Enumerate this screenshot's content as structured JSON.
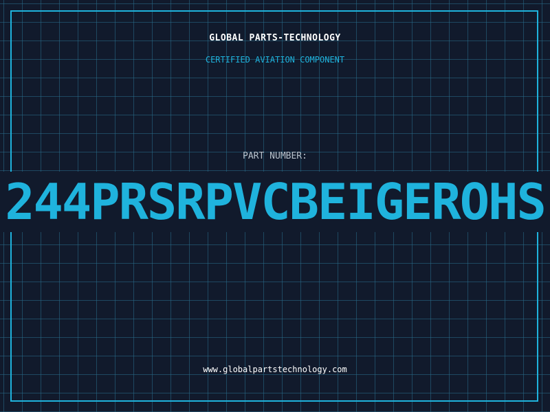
{
  "header": {
    "company": "GLOBAL PARTS-TECHNOLOGY",
    "tagline": "CERTIFIED AVIATION COMPONENT"
  },
  "part": {
    "label": "PART NUMBER:",
    "number": "244PRSRPVCBEIGEROHS"
  },
  "footer": {
    "website": "www.globalpartstechnology.com"
  },
  "colors": {
    "background": "#111a2c",
    "accent": "#1fb3dd",
    "grid": "#286e8c",
    "text": "#ffffff",
    "label": "#b8c2cc"
  }
}
